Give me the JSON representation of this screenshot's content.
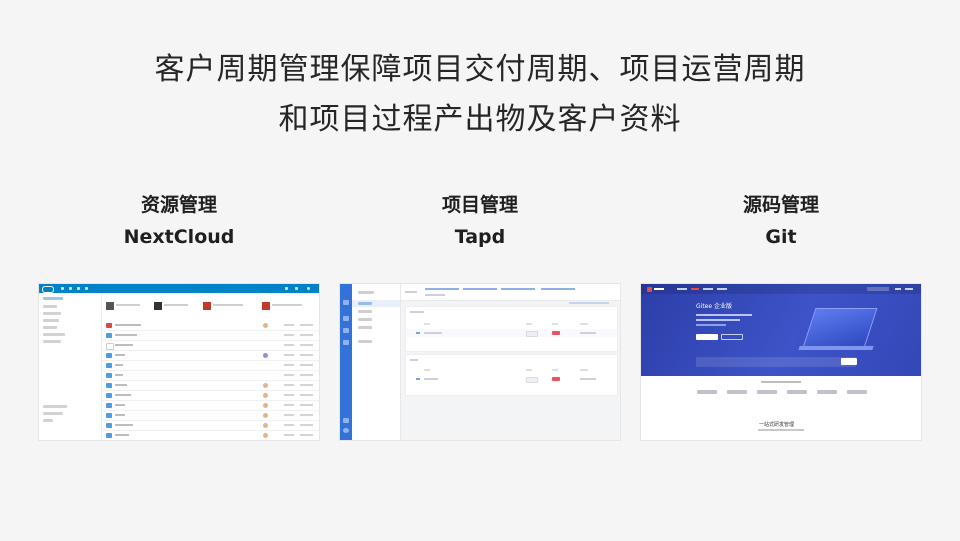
{
  "headline": {
    "line1": "客户周期管理保障项目交付周期、项目运营周期",
    "line2": "和项目过程产出物及客户资料"
  },
  "columns": [
    {
      "category": "资源管理",
      "tool": "NextCloud"
    },
    {
      "category": "项目管理",
      "tool": "Tapd"
    },
    {
      "category": "源码管理",
      "tool": "Git"
    }
  ],
  "gitee_preview": {
    "hero_title": "Gitee 企业版",
    "bottom_title": "一站式研发管理"
  },
  "colors": {
    "background": "#f5f5f5",
    "nextcloud_blue": "#0082c9",
    "tapd_blue": "#3372d9",
    "gitee_indigo": "#3d53c7",
    "gitee_red": "#e5484d"
  }
}
